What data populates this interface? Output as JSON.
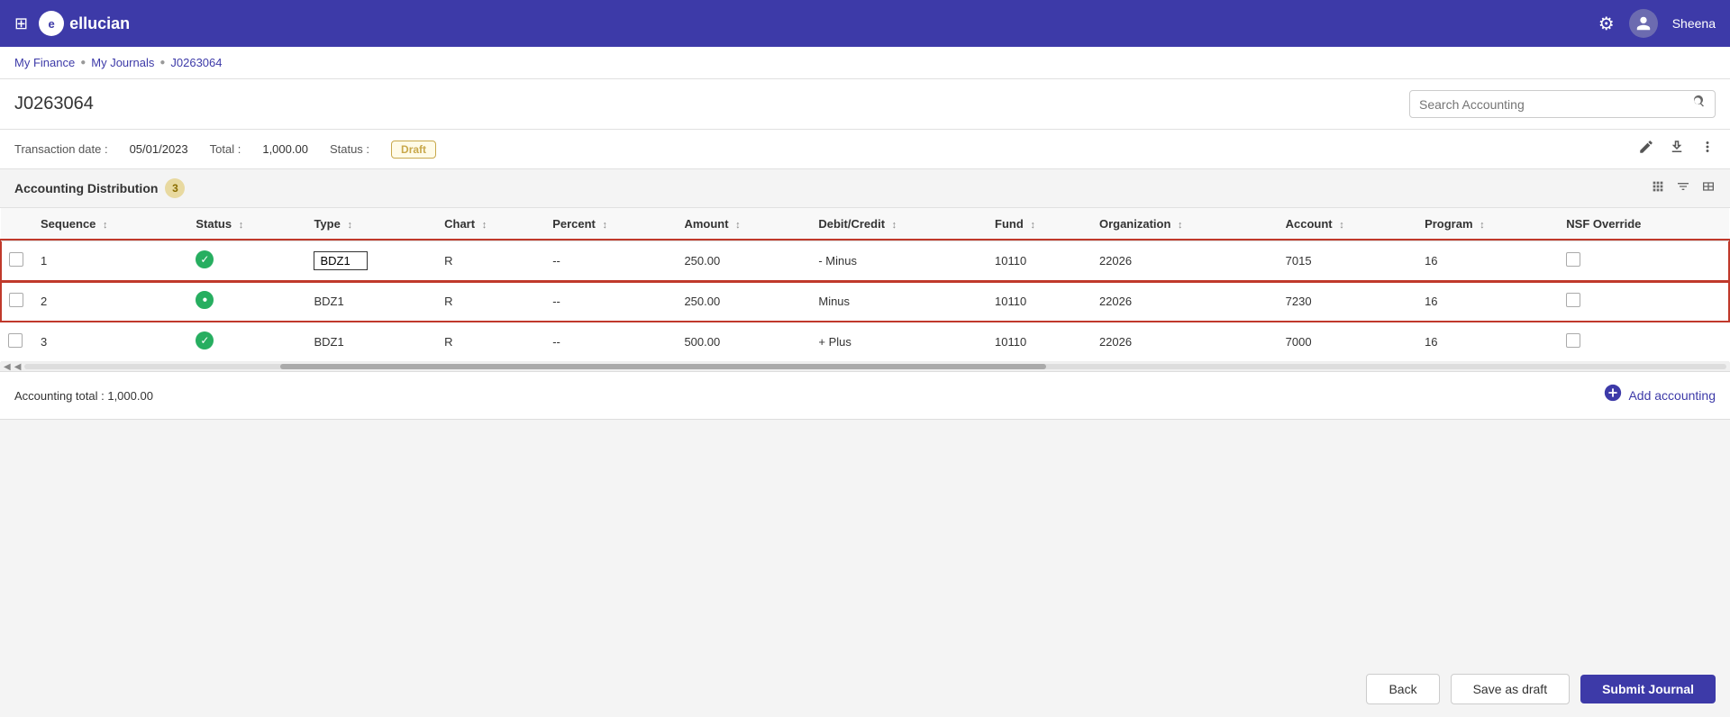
{
  "navbar": {
    "grid_icon": "⊞",
    "logo_letter": "e",
    "logo_text": "ellucian",
    "gear_icon": "⚙",
    "user_icon": "👤",
    "username": "Sheena"
  },
  "breadcrumb": {
    "items": [
      {
        "label": "My Finance",
        "href": "#"
      },
      {
        "label": "My Journals",
        "href": "#"
      },
      {
        "label": "J0263064"
      }
    ]
  },
  "page": {
    "title": "J0263064",
    "search_placeholder": "Search Accounting"
  },
  "transaction": {
    "date_label": "Transaction date :",
    "date_value": "05/01/2023",
    "total_label": "Total :",
    "total_value": "1,000.00",
    "status_label": "Status :",
    "status_value": "Draft"
  },
  "accounting_section": {
    "title": "Accounting Distribution",
    "count": "3"
  },
  "table": {
    "columns": [
      "Sequence",
      "Status",
      "Type",
      "Chart",
      "Percent",
      "Amount",
      "Debit/Credit",
      "Fund",
      "Organization",
      "Account",
      "Program",
      "NSF Override"
    ],
    "rows": [
      {
        "seq": "1",
        "status": "check",
        "type": "R",
        "chart": "BDZ1",
        "percent": "--",
        "amount": "250.00",
        "debit_credit": "- Minus",
        "fund": "10110",
        "organization": "22026",
        "account": "7015",
        "program": "16",
        "nsf": false,
        "highlight": true,
        "selected": true
      },
      {
        "seq": "2",
        "status": "partial",
        "type": "R",
        "chart": "BDZ1",
        "percent": "--",
        "amount": "250.00",
        "debit_credit": "Minus",
        "fund": "10110",
        "organization": "22026",
        "account": "7230",
        "program": "16",
        "nsf": false,
        "highlight": true,
        "selected": false
      },
      {
        "seq": "3",
        "status": "check",
        "type": "R",
        "chart": "BDZ1",
        "percent": "--",
        "amount": "500.00",
        "debit_credit": "+ Plus",
        "fund": "10110",
        "organization": "22026",
        "account": "7000",
        "program": "16",
        "nsf": false,
        "highlight": false,
        "selected": false
      }
    ]
  },
  "accounting_total": {
    "label": "Accounting total : 1,000.00"
  },
  "buttons": {
    "back": "Back",
    "save_draft": "Save as draft",
    "submit": "Submit Journal",
    "add_accounting": "Add accounting"
  }
}
